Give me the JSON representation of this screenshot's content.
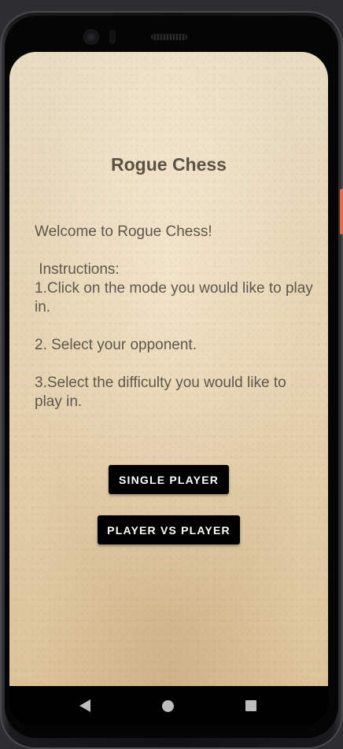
{
  "app": {
    "title": "Rogue Chess"
  },
  "main": {
    "welcome": "Welcome to Rogue Chess!",
    "instructions_heading": " Instructions:",
    "steps": [
      "1.Click on the mode you would like to play in.",
      "2. Select your opponent.",
      "3.Select the difficulty you would like to play in."
    ]
  },
  "buttons": {
    "single_player": "SINGLE PLAYER",
    "player_vs_player": "PLAYER VS PLAYER"
  },
  "navbar": {
    "back_icon": "back-triangle-icon",
    "home_icon": "home-circle-icon",
    "recents_icon": "recents-square-icon"
  },
  "colors": {
    "background": "#e6d3b1",
    "text": "#5e574d",
    "button_bg": "#000000",
    "button_text": "#ffffff"
  }
}
